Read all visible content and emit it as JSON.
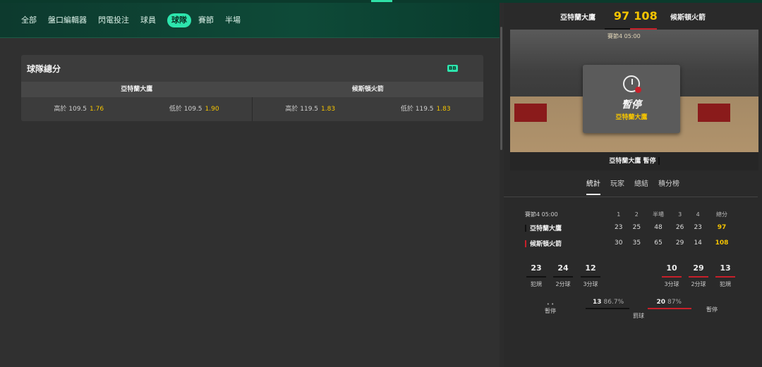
{
  "nav": {
    "tabs": [
      "全部",
      "盤口編輯器",
      "閃電投注",
      "球員",
      "球隊",
      "賽節",
      "半場"
    ],
    "active_index": 4
  },
  "card": {
    "title": "球隊總分",
    "badge": "BB",
    "teams": [
      "亞特蘭大鷹",
      "候斯頓火箭"
    ],
    "odds": [
      {
        "label": "高於 109.5",
        "price": "1.76"
      },
      {
        "label": "低於 109.5",
        "price": "1.90"
      },
      {
        "label": "高於 119.5",
        "price": "1.83"
      },
      {
        "label": "低於 119.5",
        "price": "1.83"
      }
    ]
  },
  "scoreboard": {
    "home_team": "亞特蘭大鷹",
    "home_score": "97",
    "away_score": "108",
    "away_team": "候斯頓火箭",
    "period_label": "賽節4 05:00",
    "pause_title": "暫停",
    "pause_team": "亞特蘭大鷹",
    "bottom_label": "亞特蘭大鷹 暫停"
  },
  "stat_tabs": [
    "統計",
    "玩家",
    "總結",
    "積分榜"
  ],
  "box": {
    "header": [
      "賽節4 05:00",
      "1",
      "2",
      "半場",
      "3",
      "4",
      "總分"
    ],
    "rows": [
      {
        "team": "亞特蘭大鷹",
        "color": "#111111",
        "values": [
          "23",
          "25",
          "48",
          "26",
          "23"
        ],
        "total": "97"
      },
      {
        "team": "候斯頓火箭",
        "color": "#c8202a",
        "values": [
          "30",
          "35",
          "65",
          "29",
          "14"
        ],
        "total": "108"
      }
    ]
  },
  "stats": {
    "home": [
      {
        "v": "23",
        "lb": "犯規"
      },
      {
        "v": "24",
        "lb": "2分球"
      },
      {
        "v": "12",
        "lb": "3分球"
      }
    ],
    "away": [
      {
        "v": "10",
        "lb": "3分球"
      },
      {
        "v": "29",
        "lb": "2分球"
      },
      {
        "v": "13",
        "lb": "犯規"
      }
    ],
    "pause_label": "暫停",
    "free_throws": {
      "home_made": "13",
      "home_pct": "86.7%",
      "away_made": "20",
      "away_pct": "87%",
      "label": "罰球"
    }
  },
  "colors": {
    "accent": "#2de5ad",
    "price": "#f5c400",
    "away": "#c8202a",
    "home": "#111111"
  }
}
